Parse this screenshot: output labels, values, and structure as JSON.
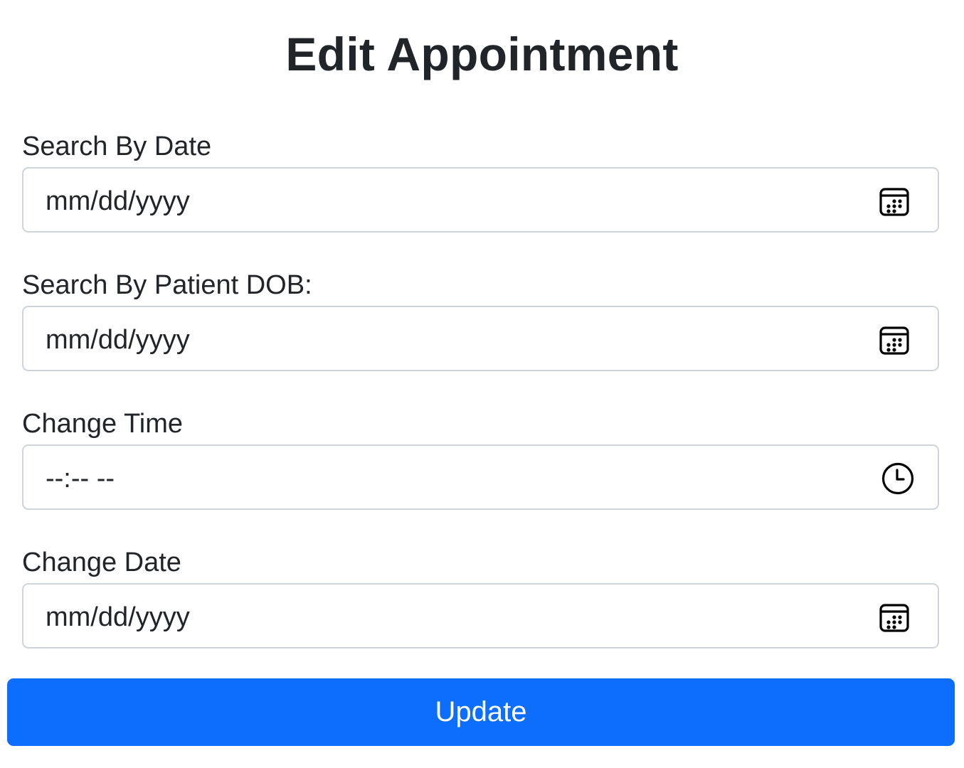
{
  "page": {
    "title": "Edit Appointment"
  },
  "form": {
    "search_by_date": {
      "label": "Search By Date",
      "value": "mm/dd/yyyy",
      "icon": "calendar-icon"
    },
    "search_by_patient_dob": {
      "label": "Search By Patient DOB:",
      "value": "mm/dd/yyyy",
      "icon": "calendar-icon"
    },
    "change_time": {
      "label": "Change Time",
      "value": "--:-- --",
      "icon": "clock-icon"
    },
    "change_date": {
      "label": "Change Date",
      "value": "mm/dd/yyyy",
      "icon": "calendar-icon"
    },
    "submit_label": "Update"
  },
  "colors": {
    "primary": "#0d6efd",
    "text": "#212529",
    "border": "#ced4da",
    "background": "#ffffff"
  }
}
